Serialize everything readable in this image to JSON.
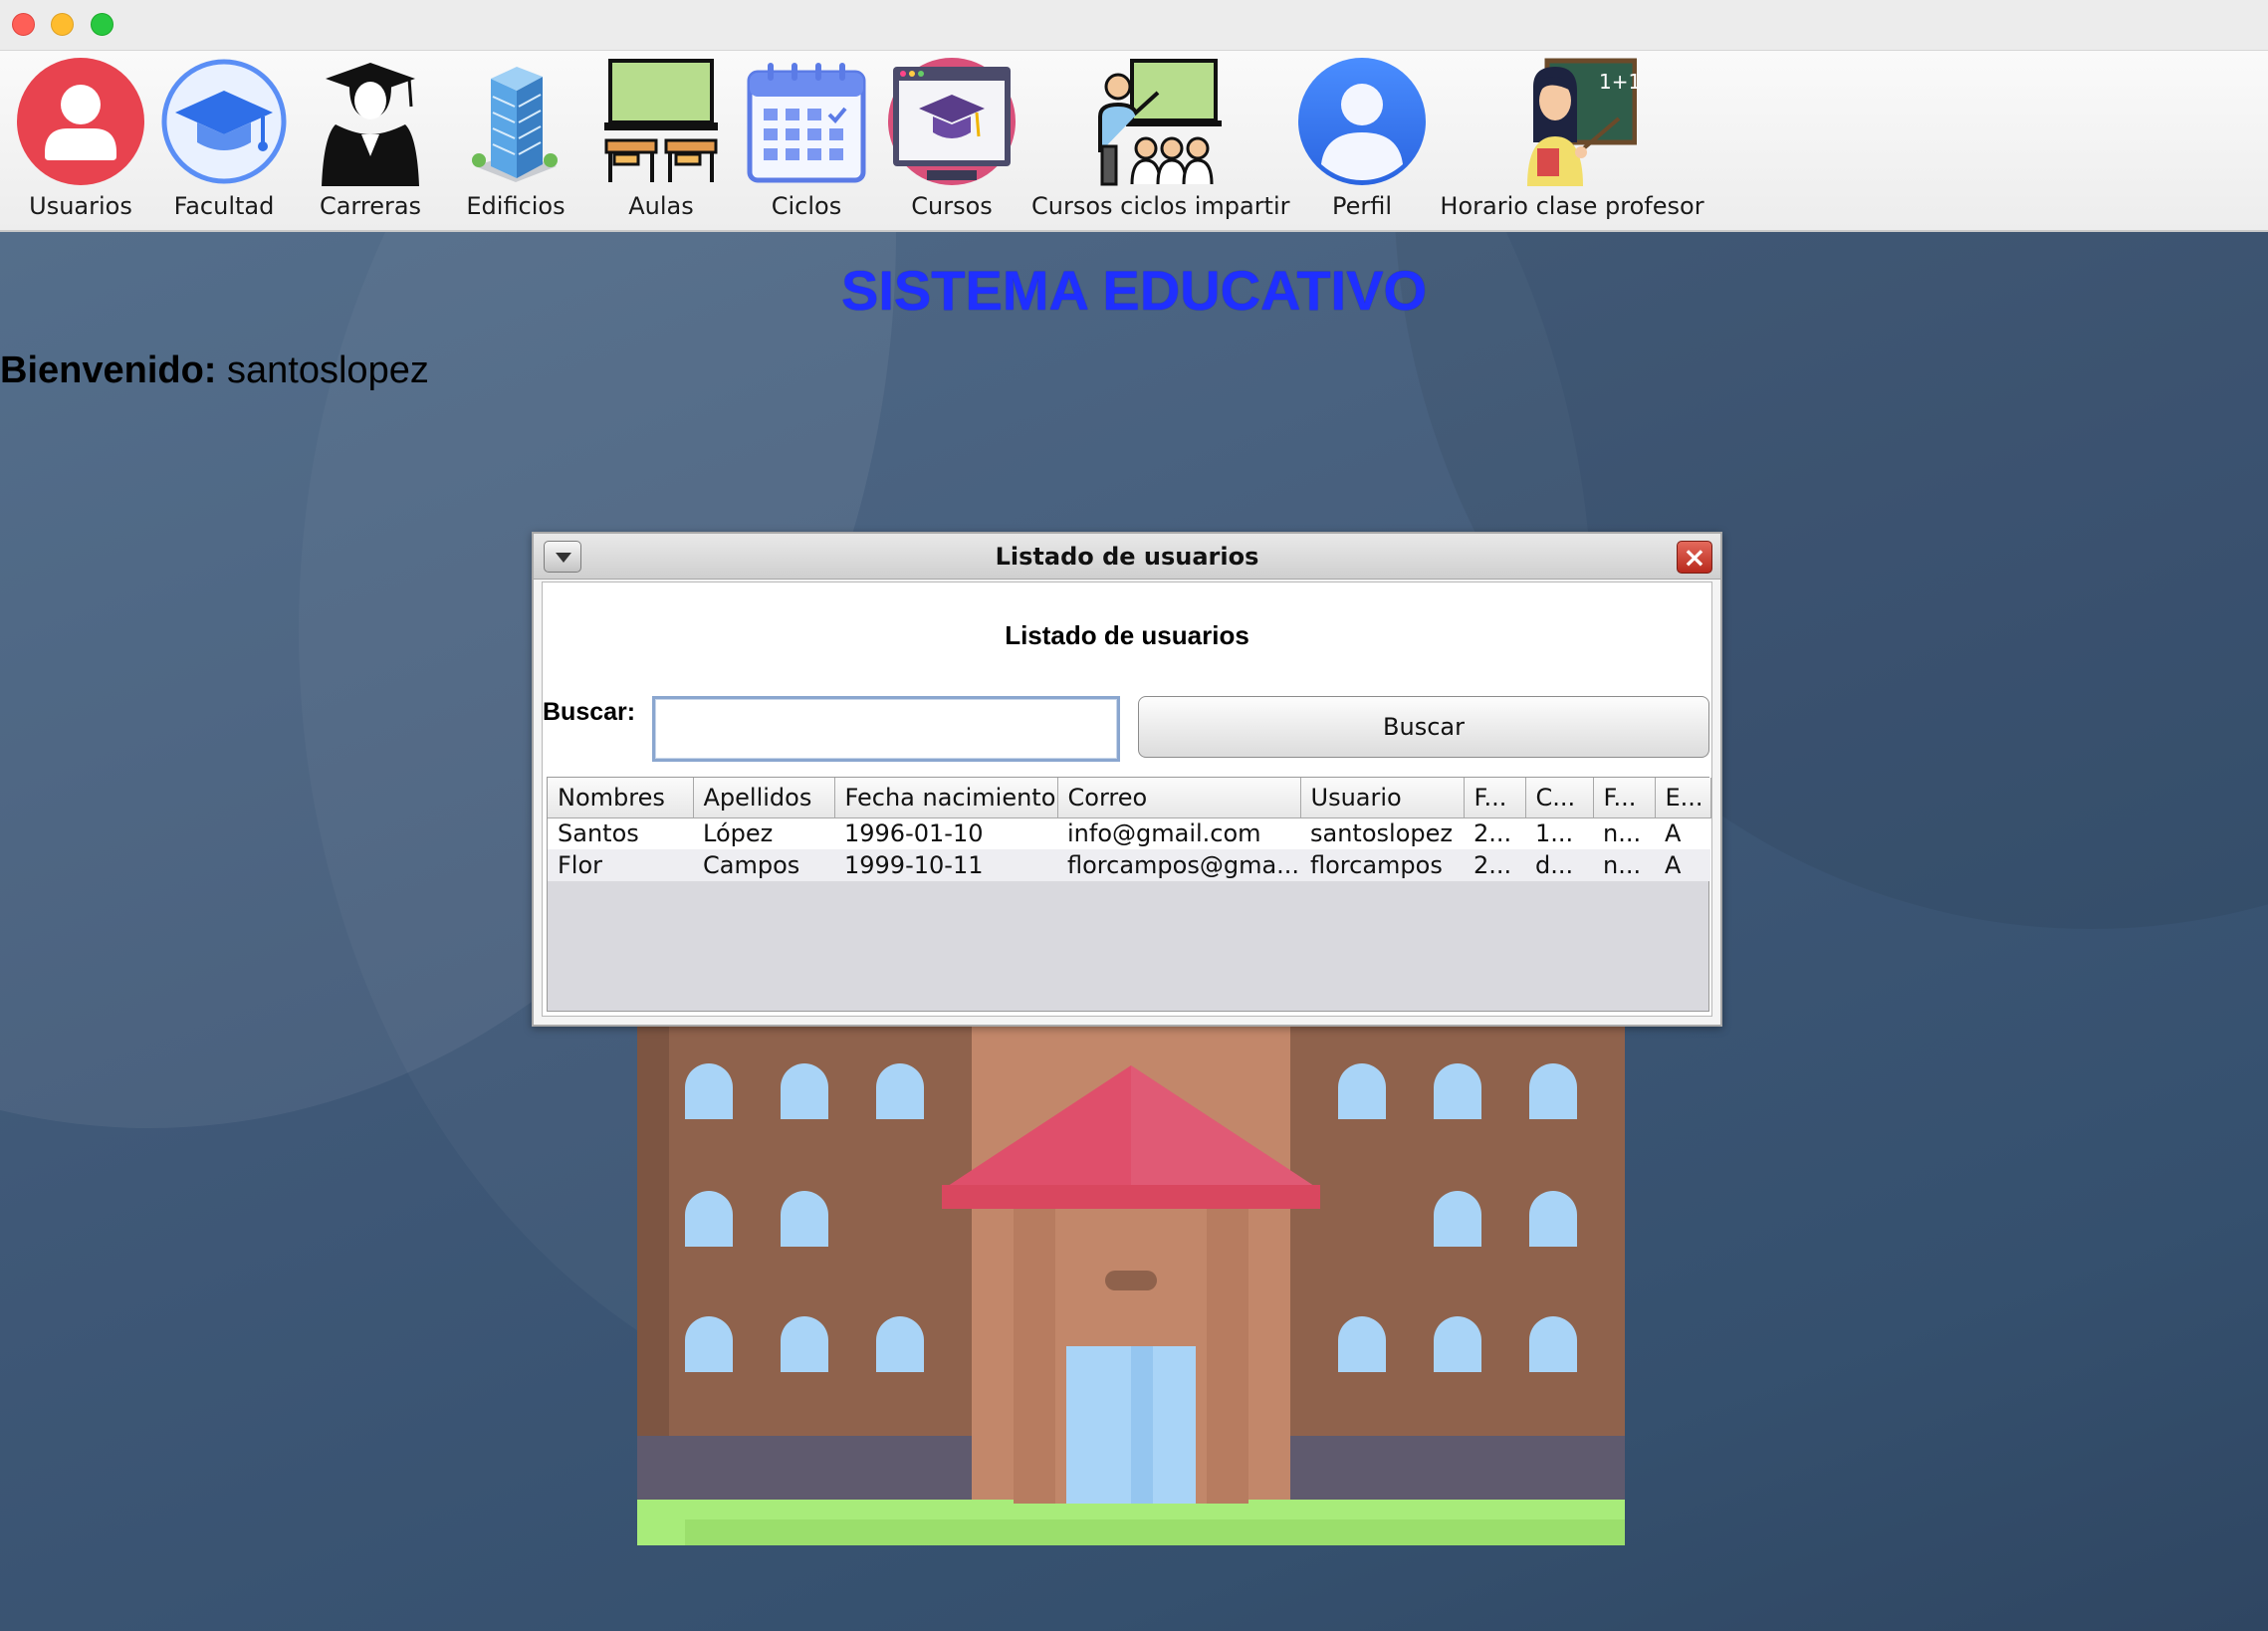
{
  "window": {
    "controls": [
      "close",
      "minimize",
      "maximize"
    ]
  },
  "toolbar": {
    "items": [
      {
        "label": "Usuarios",
        "icon": "user-circle-icon"
      },
      {
        "label": "Facultad",
        "icon": "graduation-cap-icon"
      },
      {
        "label": "Carreras",
        "icon": "graduate-person-icon"
      },
      {
        "label": "Edificios",
        "icon": "building-icon"
      },
      {
        "label": "Aulas",
        "icon": "classroom-icon"
      },
      {
        "label": "Ciclos",
        "icon": "calendar-icon"
      },
      {
        "label": "Cursos",
        "icon": "online-course-icon"
      },
      {
        "label": "Cursos ciclos impartir",
        "icon": "teacher-class-icon"
      },
      {
        "label": "Perfil",
        "icon": "profile-icon"
      },
      {
        "label": "Horario clase profesor",
        "icon": "teacher-board-icon"
      }
    ]
  },
  "main": {
    "title": "SISTEMA EDUCATIVO",
    "welcome_label": "Bienvenido:",
    "welcome_user": "santoslopez",
    "background_image": "school-building-icon"
  },
  "dialog": {
    "title": "Listado de usuarios",
    "heading": "Listado de usuarios",
    "search_label": "Buscar:",
    "search_value": "",
    "search_button": "Buscar",
    "columns": [
      "Nombres",
      "Apellidos",
      "Fecha nacimiento",
      "Correo",
      "Usuario",
      "F...",
      "C...",
      "F...",
      "E..."
    ],
    "rows": [
      [
        "Santos",
        "López",
        "1996-01-10",
        "info@gmail.com",
        "santoslopez",
        "2...",
        "1...",
        "n...",
        "A"
      ],
      [
        "Flor",
        "Campos",
        "1999-10-11",
        "florcampos@gma...",
        "florcampos",
        "2...",
        "d...",
        "n...",
        "A"
      ]
    ]
  },
  "colors": {
    "title_blue": "#1f2fff",
    "desktop_bg": "#3f5877",
    "close_button": "#c8392b"
  }
}
